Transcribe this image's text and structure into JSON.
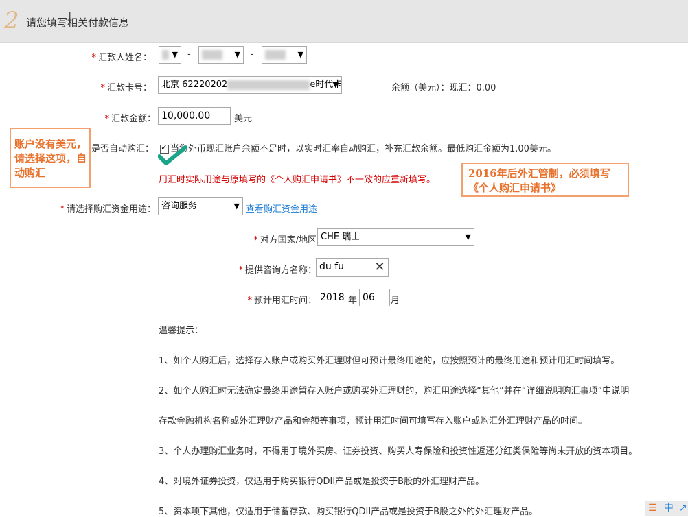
{
  "header": {
    "step": "2",
    "title": "请您填写相关付款信息",
    "cursor": "I"
  },
  "form": {
    "name_label": "汇款人姓名：",
    "name_selects": [
      "",
      "",
      ""
    ],
    "name_dash": "-",
    "card_label": "汇款卡号：",
    "card_prefix": "北京 62220202",
    "card_suffix": "e时代卡",
    "balance_text": "余额（美元）：现汇：0.00",
    "amount_label": "汇款金额：",
    "amount_value": "10,000.00",
    "amount_unit": "美元",
    "auto_label": "是否自动购汇：",
    "auto_text": "当您外币现汇账户余额不足时，以实时汇率自动购汇，补充汇款余额。最低购汇金额为1.00美元。",
    "warning": "用汇时实际用途与原填写的《个人购汇申请书》不一致的应重新填写。",
    "purpose_label": "请选择购汇资金用途：",
    "purpose_value": "咨询服务",
    "purpose_link": "查看购汇资金用途",
    "country_label": "对方国家/地区",
    "country_value": "CHE 瑞士",
    "consultant_label": "提供咨询方名称：",
    "consultant_value": "du fu",
    "date_label": "预计用汇时间：",
    "year_value": "2018",
    "year_unit": "年",
    "month_value": "06",
    "month_unit": "月"
  },
  "notes": {
    "left": "账户没有美元，请选择这项，自动购汇",
    "right": "2016年后外汇管制，必须填写《个人购汇申请书》"
  },
  "tips": {
    "title": "温馨提示：",
    "items": [
      "1、如个人购汇后，选择存入账户或购买外汇理财但可预计最终用途的，应按照预计的最终用途和预计用汇时间填写。",
      "2、如个人购汇时无法确定最终用途暂存入账户或购买外汇理财的，购汇用途选择“其他”并在“详细说明购汇事项”中说明",
      "存款金融机构名称或外汇理财产品和金额等事项，预计用汇时间可填写存入账户或购汇外汇理财产品的时间。",
      "3、个人办理购汇业务时，不得用于境外买房、证券投资、购买人寿保险和投资性返还分红类保险等尚未开放的资本项目。",
      "4、对境外证券投资，仅适用于购买银行QDII产品或是投资于B股的外汇理财产品。",
      "5、资本项下其他，仅适用于储蓄存款、购买银行QDII产品或是投资于B股之外的外汇理财产品。"
    ]
  },
  "tray": {
    "ime_left": "☰",
    "ime_mid": "中",
    "ime_right": "↗"
  },
  "colors": {
    "required": "#d40000",
    "link": "#1a7ad4",
    "note": "#e8712c",
    "check": "#1aa58a"
  }
}
